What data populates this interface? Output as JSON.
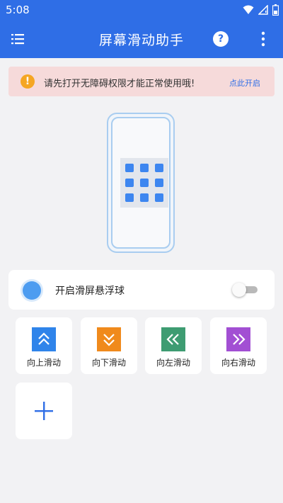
{
  "status_bar": {
    "time": "5:08",
    "icons": [
      "wifi-icon",
      "signal-icon",
      "battery-icon"
    ]
  },
  "app_bar": {
    "title": "屏幕滑动助手",
    "help_label": "?",
    "icons": [
      "menu-icon",
      "help-icon",
      "more-vert-icon"
    ]
  },
  "warning": {
    "icon_label": "!",
    "message": "请先打开无障碍权限才能正常使用哦!",
    "action": "点此开启"
  },
  "floating_ball": {
    "label": "开启滑屏悬浮球",
    "enabled": false
  },
  "actions": [
    {
      "label": "向上滑动",
      "icon": "chevron-double-up-icon",
      "color": "#2f84ea"
    },
    {
      "label": "向下滑动",
      "icon": "chevron-double-down-icon",
      "color": "#f08a1c"
    },
    {
      "label": "向左滑动",
      "icon": "chevron-double-left-icon",
      "color": "#3e9c72"
    },
    {
      "label": "向右滑动",
      "icon": "chevron-double-right-icon",
      "color": "#a24fd3"
    }
  ],
  "add_tile": {
    "icon": "plus-icon",
    "color": "#2f6ee6"
  },
  "colors": {
    "primary": "#2f6ee6",
    "warning_bg": "#f6dada",
    "warning_icon": "#f5a623",
    "page_bg": "#f2f2f4"
  }
}
